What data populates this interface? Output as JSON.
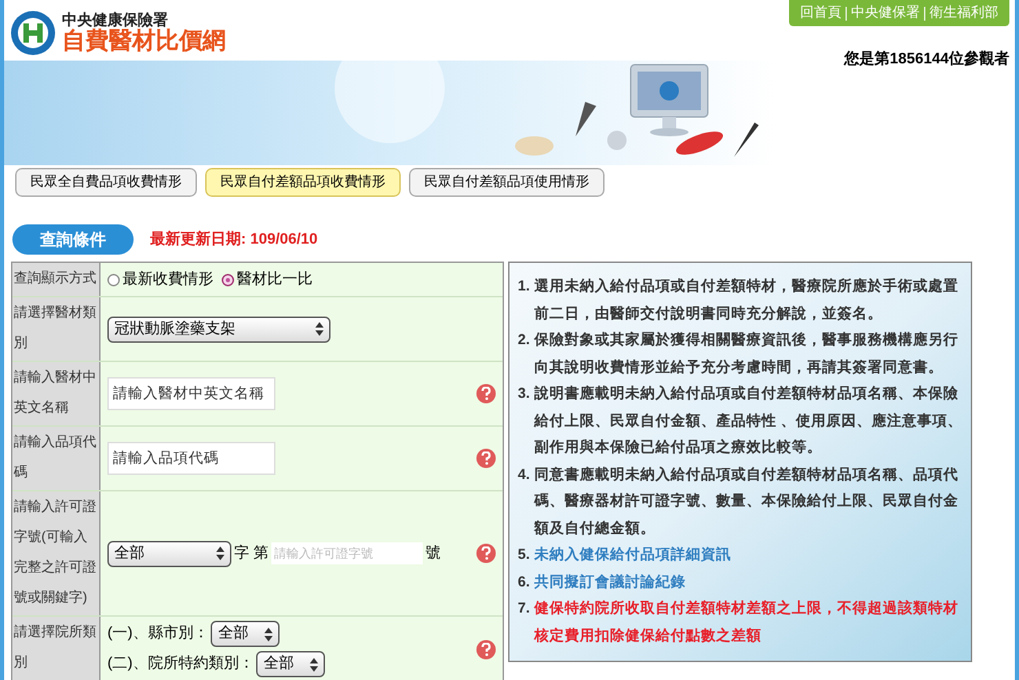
{
  "header": {
    "org": "中央健康保險署",
    "site": "自費醫材比價網"
  },
  "top_links": [
    "回首頁",
    "中央健保署",
    "衛生福利部"
  ],
  "visitor": "您是第1856144位參觀者",
  "tabs": [
    {
      "label": "民眾全自費品項收費情形",
      "selected": false
    },
    {
      "label": "民眾自付差額品項收費情形",
      "selected": true
    },
    {
      "label": "民眾自付差額品項使用情形",
      "selected": false
    }
  ],
  "query_title": "查詢條件",
  "update_date": "最新更新日期: 109/06/10",
  "form": [
    {
      "kind": "radio",
      "label": "查詢顯示方式",
      "help": false,
      "options": [
        {
          "label": "最新收費情形",
          "selected": false
        },
        {
          "label": "醫材比一比",
          "selected": true
        }
      ]
    },
    {
      "kind": "select",
      "label": "請選擇醫材類別",
      "help": false,
      "value": "冠狀動脈塗藥支架"
    },
    {
      "kind": "text",
      "label": "請輸入醫材中英文名稱",
      "help": true,
      "placeholder": "請輸入醫材中英文名稱"
    },
    {
      "kind": "text",
      "label": "請輸入品項代碼",
      "help": true,
      "placeholder": "請輸入品項代碼"
    },
    {
      "kind": "license",
      "label": "請輸入許可證字號(可輸入完整之許可證號或關鍵字)",
      "help": true,
      "value": "全部",
      "middle": "字 第",
      "placeholder": "請輸入許可證字號",
      "suffix": "號"
    },
    {
      "kind": "hospital",
      "label": "請選擇院所類別",
      "help": true,
      "fields": [
        {
          "label": "(一)、縣市別：",
          "value": "全部"
        },
        {
          "label": "(二)、院所特約類別：",
          "value": "全部"
        }
      ]
    }
  ],
  "notes": [
    {
      "kind": "text",
      "number": "1.",
      "text": "選用未納入給付品項或自付差額特材，醫療院所應於手術或處置前二日，由醫師交付說明書同時充分解說，並簽名。"
    },
    {
      "kind": "text",
      "number": "2.",
      "text": "保險對象或其家屬於獲得相關醫療資訊後，醫事服務機構應另行向其說明收費情形並給予充分考慮時間，再請其簽署同意書。"
    },
    {
      "kind": "text",
      "number": "3.",
      "text": "說明書應載明未納入給付品項或自付差額特材品項名稱、本保險給付上限、民眾自付金額、產品特性 、使用原因、應注意事項、副作用與本保險已給付品項之療效比較等。"
    },
    {
      "kind": "text",
      "number": "4.",
      "text": "同意書應載明未納入給付品項或自付差額特材品項名稱、品項代碼、醫療器材許可證字號、數量、本保險給付上限、民眾自付金額及自付總金額。"
    },
    {
      "kind": "link",
      "number": "5.",
      "text": "未納入健保給付品項詳細資訊"
    },
    {
      "kind": "link",
      "number": "6.",
      "text": "共同擬訂會議討論紀錄"
    },
    {
      "kind": "warning",
      "number": "7.",
      "text": "健保特約院所收取自付差額特材差額之上限，不得超過該類特材核定費用扣除健保給付點數之差額"
    }
  ]
}
